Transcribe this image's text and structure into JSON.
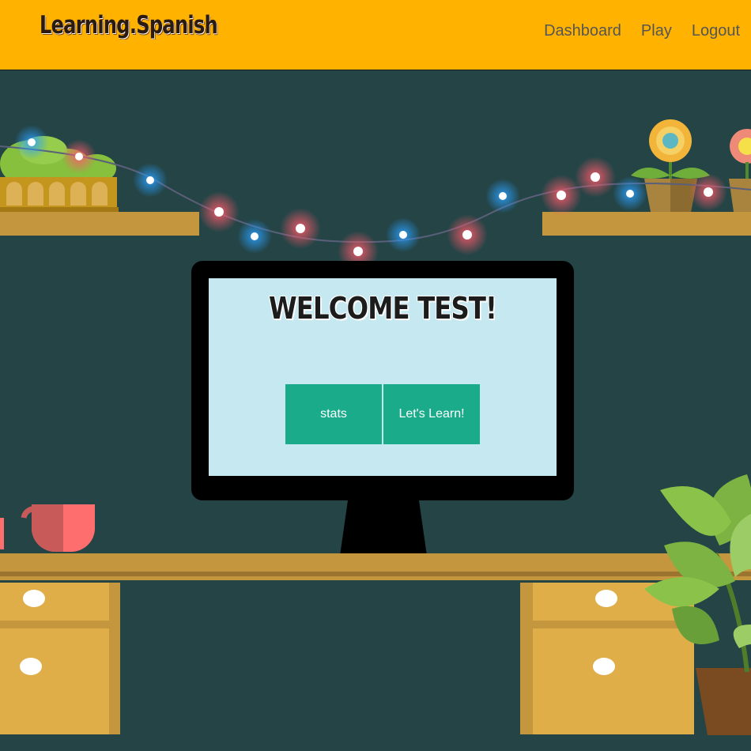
{
  "header": {
    "logo": "Learning.Spanish",
    "nav": {
      "dashboard": "Dashboard",
      "play": "Play",
      "logout": "Logout"
    },
    "background_color": "#FFB300"
  },
  "main": {
    "welcome": "WELCOME TEST!",
    "buttons": {
      "stats": "stats",
      "learn": "Let's Learn!"
    },
    "button_color": "#1AAB8A",
    "screen_color": "#C6E8F1",
    "wall_color": "#244446"
  }
}
